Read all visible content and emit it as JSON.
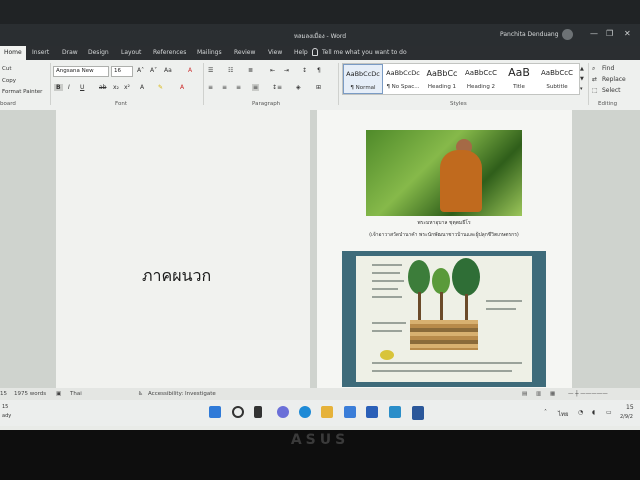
{
  "window": {
    "title": "หลมลงเมื่อง - Word",
    "user": "Panchita Denduang",
    "minimize": "—",
    "restore": "❐",
    "close": "✕"
  },
  "tabs": [
    "Home",
    "Insert",
    "Draw",
    "Design",
    "Layout",
    "References",
    "Mailings",
    "Review",
    "View",
    "Help"
  ],
  "tell_me": "Tell me what you want to do",
  "clipboard": {
    "cut": "Cut",
    "copy": "Copy",
    "format_painter": "Format Painter",
    "label": "board"
  },
  "font": {
    "name": "Angsana New",
    "size": "16",
    "label": "Font"
  },
  "paragraph": {
    "label": "Paragraph"
  },
  "styles": {
    "label": "Styles",
    "items": [
      {
        "sample": "AaBbCcDc",
        "name": "¶ Normal"
      },
      {
        "sample": "AaBbCcDc",
        "name": "¶ No Spac..."
      },
      {
        "sample": "AaBbCc",
        "name": "Heading 1"
      },
      {
        "sample": "AaBbCcC",
        "name": "Heading 2"
      },
      {
        "sample": "AaB",
        "name": "Title"
      },
      {
        "sample": "AaBbCcC",
        "name": "Subtitle"
      }
    ]
  },
  "editing": {
    "find": "Find",
    "replace": "Replace",
    "select": "Select",
    "label": "Editing"
  },
  "document": {
    "page1_heading": "ภาคผนวก",
    "photo_caption_1": "พระมหาอุบาล ชุตฺตมธีโร",
    "photo_caption_2": "(เจ้าอาวาสวัดป่านาคำ พระนักพัฒนาชาวบ้านและผู้ปลุกชีวิตเกษตรกร)"
  },
  "status": {
    "page": "15",
    "words": "1975 words",
    "language": "Thai",
    "accessibility": "Accessibility: Investigate",
    "left_note": "ady"
  },
  "taskbar": {
    "lang": "ไทย",
    "time": "15",
    "date": "2/9/2"
  },
  "device_brand": "ASUS"
}
